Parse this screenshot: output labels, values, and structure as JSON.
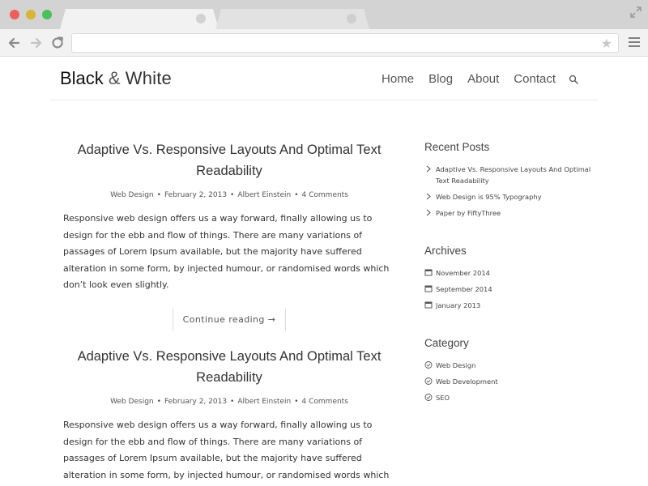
{
  "browser": {
    "address_value": ""
  },
  "site": {
    "logo_main": "Black",
    "logo_amp": "&",
    "logo_secondary": "White",
    "nav": [
      "Home",
      "Blog",
      "About",
      "Contact"
    ]
  },
  "posts": [
    {
      "title": "Adaptive Vs. Responsive Layouts And Optimal Text Readability",
      "category": "Web Design",
      "date": "February 2, 2013",
      "author": "Albert Einstein",
      "comments": "4 Comments",
      "excerpt": "Responsive web design offers us a way forward, finally allowing us to design for the ebb and flow of things. There are many variations of passages of Lorem Ipsum available, but the majority have suffered alteration in some form, by injected humour, or randomised words which don’t look even slightly.",
      "continue_label": "Continue reading →"
    },
    {
      "title": "Adaptive Vs. Responsive Layouts And Optimal Text Readability",
      "category": "Web Design",
      "date": "February 2, 2013",
      "author": "Albert Einstein",
      "comments": "4 Comments",
      "excerpt": "Responsive web design offers us a way forward, finally allowing us to design for the ebb and flow of things. There are many variations of passages of Lorem Ipsum available, but the majority have suffered alteration in some form, by injected humour, or randomised words which don’t look even slightly."
    }
  ],
  "sidebar": {
    "recent_posts": {
      "title": "Recent Posts",
      "items": [
        "Adaptive Vs. Responsive Layouts And Optimal Text Readability",
        "Web Design is 95% Typography",
        "Paper by FiftyThree"
      ]
    },
    "archives": {
      "title": "Archives",
      "items": [
        "November 2014",
        "September 2014",
        "January 2013"
      ]
    },
    "category": {
      "title": "Category",
      "items": [
        "Web Design",
        "Web Development",
        "SEO"
      ]
    }
  },
  "icons": {
    "recent": "chevron-right-icon",
    "archive": "calendar-icon",
    "category": "check-circle-icon",
    "search": "search-icon"
  },
  "colors": {
    "chrome_bg": "#d3d3d3",
    "toolbar_bg": "#f2f2f2",
    "traffic_red": "#ec5f5a",
    "traffic_yellow": "#d8b532",
    "traffic_green": "#4cbf5c",
    "text": "#333333"
  }
}
